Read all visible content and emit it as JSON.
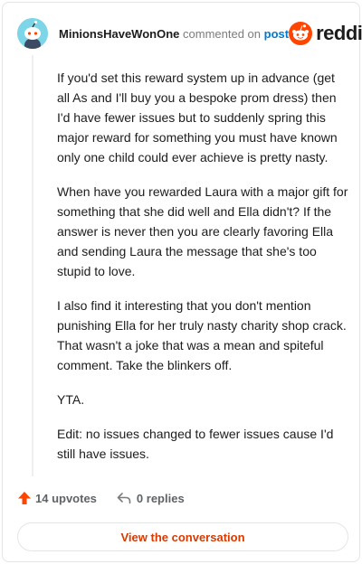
{
  "comment": {
    "username": "MinionsHaveWonOne",
    "action_text": "commented on",
    "post_link": "post"
  },
  "brand": {
    "name": "reddit",
    "color": "#ff4500"
  },
  "body": [
    "If you'd set this reward system up in advance (get all As and I'll buy you a bespoke prom dress) then I'd have fewer issues but to suddenly spring this major reward for something you must have known only one child could ever achieve is pretty nasty.",
    "When have you rewarded Laura with a major gift for something that she did well and Ella didn't? If the answer is never then you are clearly favoring Ella and sending Laura the message that she's too stupid to love.",
    "I also find it interesting that you don't mention punishing Ella for her truly nasty charity shop crack. That wasn't a joke that was a mean and spiteful comment. Take the blinkers off.",
    "YTA.",
    "Edit: no issues changed to fewer issues cause I'd still have issues."
  ],
  "footer": {
    "upvotes": "14 upvotes",
    "replies": "0 replies"
  },
  "cta": {
    "label": "View the conversation",
    "color": "#d93a00"
  },
  "icons": {
    "avatar": "snoo-avatar-icon",
    "logo": "reddit-logo-icon",
    "upvote": "upvote-arrow-icon",
    "reply": "reply-arrow-icon"
  }
}
